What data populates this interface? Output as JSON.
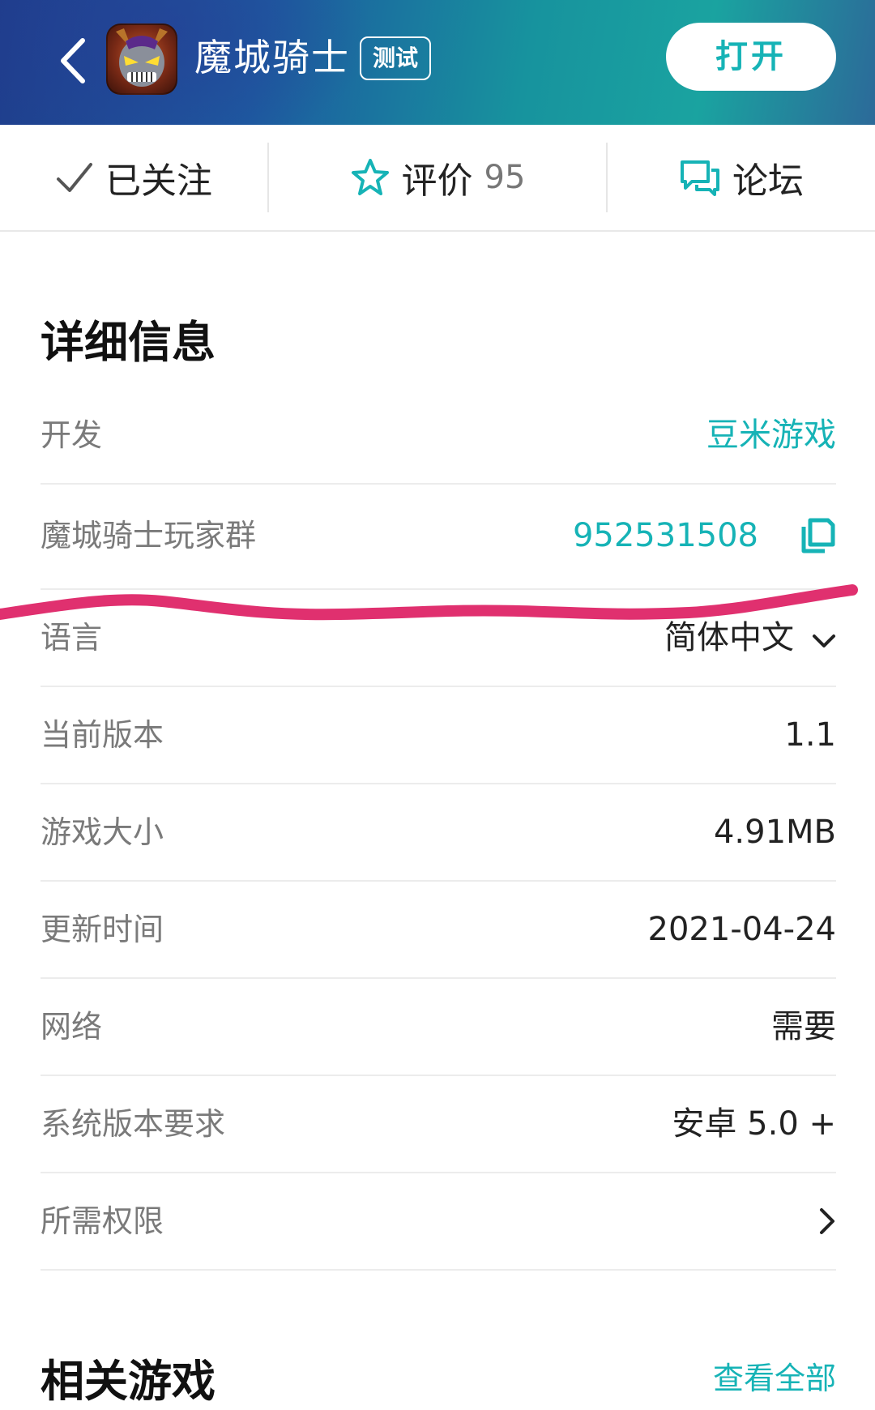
{
  "header": {
    "back_icon": "chevron-left-icon",
    "app_icon": "game-avatar-icon",
    "title": "魔城骑士",
    "badge": "测试",
    "open_label": "打开"
  },
  "action_bar": {
    "follow": {
      "icon": "check-icon",
      "label": "已关注"
    },
    "rating": {
      "icon": "star-outline-icon",
      "label": "评价",
      "count": "95"
    },
    "forum": {
      "icon": "chat-bubbles-icon",
      "label": "论坛"
    }
  },
  "details": {
    "title": "详细信息",
    "rows": [
      {
        "label": "开发",
        "value": "豆米游戏"
      },
      {
        "label": "魔城骑士玩家群",
        "value": "952531508",
        "icon": "copy-icon"
      },
      {
        "label": "语言",
        "value": "简体中文",
        "icon": "chevron-down-icon"
      },
      {
        "label": "当前版本",
        "value": "1.1"
      },
      {
        "label": "游戏大小",
        "value": "4.91MB"
      },
      {
        "label": "更新时间",
        "value": "2021-04-24"
      },
      {
        "label": "网络",
        "value": "需要"
      },
      {
        "label": "系统版本要求",
        "value": "安卓 5.0 +"
      },
      {
        "label": "所需权限",
        "value": "",
        "icon": "chevron-right-icon"
      }
    ]
  },
  "related": {
    "title": "相关游戏",
    "see_all": "查看全部"
  },
  "colors": {
    "accent": "#16b3b6",
    "annotation_stroke": "#e0306f",
    "header_gradient_start": "#1f3d8c",
    "header_gradient_end": "#1aa3a0"
  }
}
